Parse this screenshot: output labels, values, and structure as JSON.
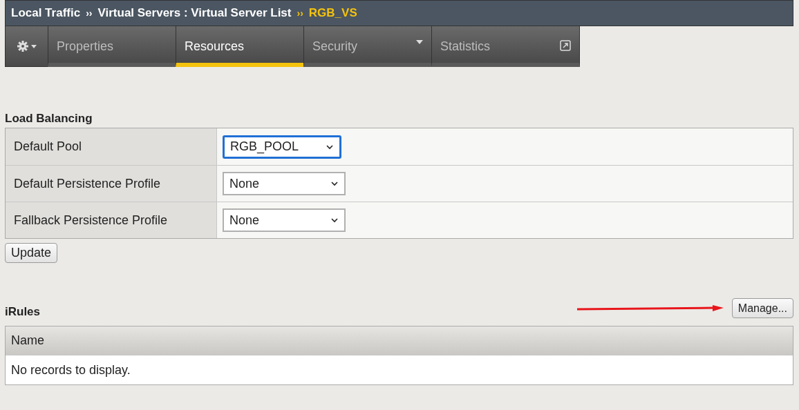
{
  "breadcrumb": {
    "items": [
      {
        "label": "Local Traffic",
        "separator": "››"
      },
      {
        "label": "Virtual Servers : Virtual Server List",
        "separator": "››"
      }
    ],
    "current": "RGB_VS"
  },
  "tabs": [
    {
      "label": "Properties",
      "selected": false,
      "kind": "plain"
    },
    {
      "label": "Resources",
      "selected": true,
      "kind": "plain"
    },
    {
      "label": "Security",
      "selected": false,
      "kind": "menu"
    },
    {
      "label": "Statistics",
      "selected": false,
      "kind": "external"
    }
  ],
  "load_balancing": {
    "title": "Load Balancing",
    "rows": [
      {
        "label": "Default Pool",
        "value": "RGB_POOL",
        "focused": true
      },
      {
        "label": "Default Persistence Profile",
        "value": "None",
        "focused": false
      },
      {
        "label": "Fallback Persistence Profile",
        "value": "None",
        "focused": false
      }
    ],
    "button": "Update"
  },
  "irules": {
    "title": "iRules",
    "manage": "Manage...",
    "columns": [
      "Name"
    ],
    "empty": "No records to display."
  }
}
